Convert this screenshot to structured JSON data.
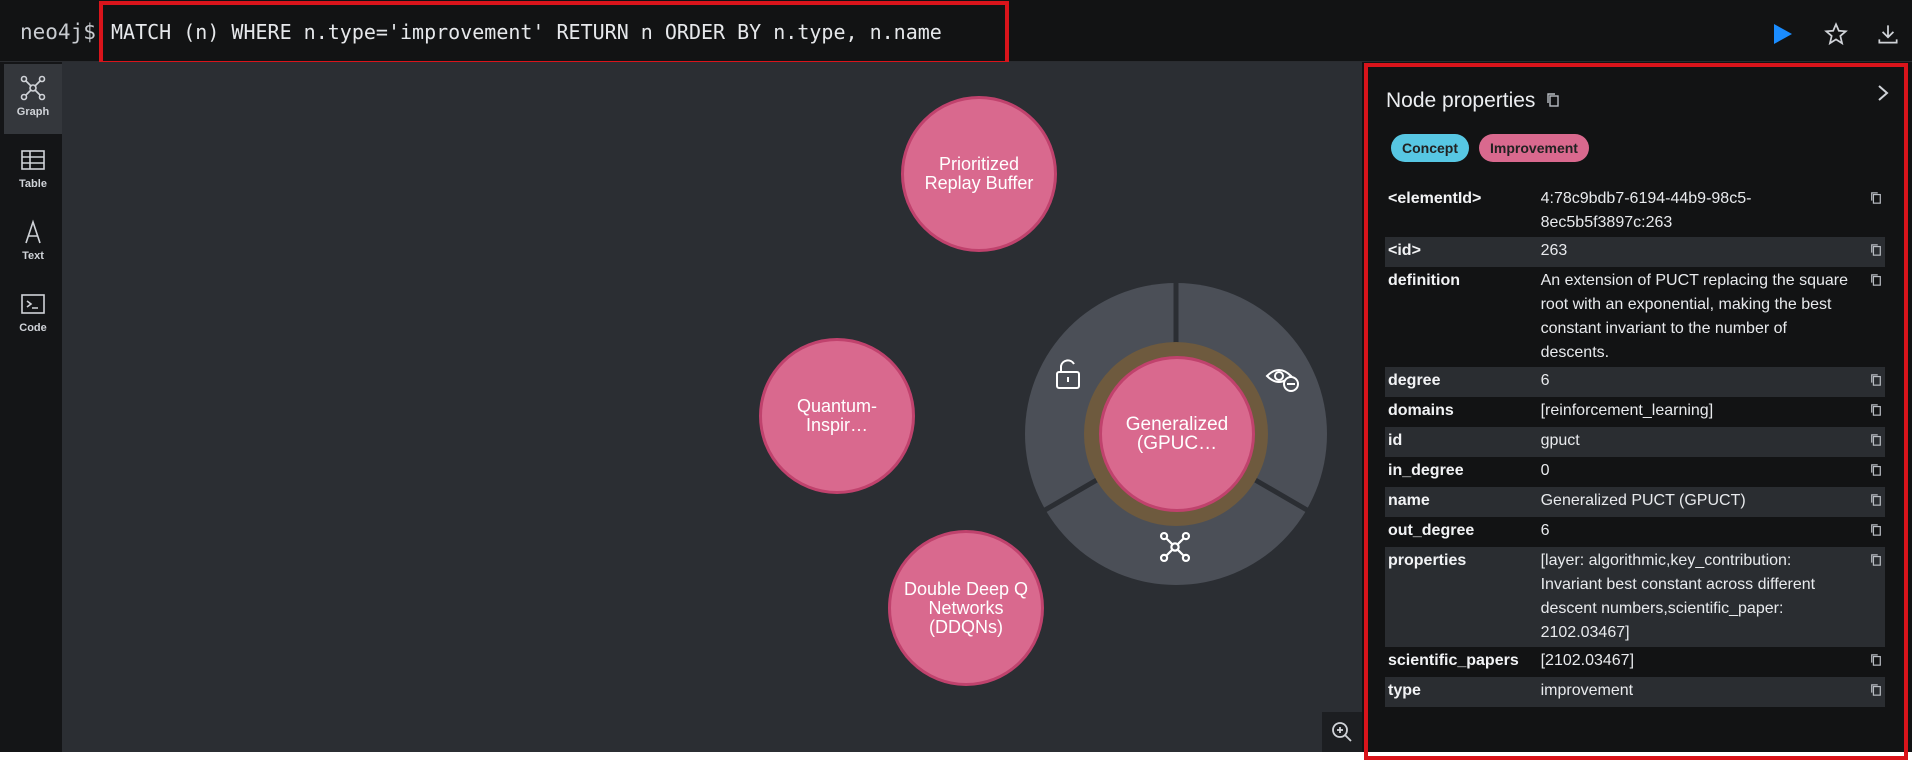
{
  "query": {
    "prompt": "neo4j$",
    "text": "MATCH (n) WHERE n.type='improvement' RETURN n ORDER BY n.type, n.name"
  },
  "sidebar": {
    "items": [
      {
        "label": "Graph",
        "icon": "graph-icon",
        "active": true
      },
      {
        "label": "Table",
        "icon": "table-icon"
      },
      {
        "label": "Text",
        "icon": "text-icon"
      },
      {
        "label": "Code",
        "icon": "code-icon"
      }
    ]
  },
  "graph": {
    "nodes": [
      {
        "caption_line1": "Prioritized",
        "caption_line2": "Replay Buffer"
      },
      {
        "caption_line1": "Quantum-Inspir…"
      },
      {
        "caption_line1": "Double Deep Q",
        "caption_line2": "Networks",
        "caption_line3": "(DDQNs)"
      },
      {
        "caption_line1": "Generalized",
        "caption_line2": "(GPUC…",
        "selected": true
      }
    ],
    "node_color": "#d9698e",
    "node_border": "#c0426d",
    "ring_menu": [
      "unlock-icon",
      "hide-icon",
      "expand-icon"
    ]
  },
  "panel": {
    "title": "Node properties",
    "labels": [
      {
        "text": "Concept",
        "color": "#57c7e3"
      },
      {
        "text": "Improvement",
        "color": "#d9698e"
      }
    ],
    "properties": [
      {
        "key": "<elementId>",
        "value": "4:78c9bdb7-6194-44b9-98c5-8ec5b5f3897c:263"
      },
      {
        "key": "<id>",
        "value": "263"
      },
      {
        "key": "definition",
        "value": "An extension of PUCT replacing the square root with an exponential, making the best constant invariant to the number of descents."
      },
      {
        "key": "degree",
        "value": "6"
      },
      {
        "key": "domains",
        "value": "[reinforcement_learning]"
      },
      {
        "key": "id",
        "value": "gpuct"
      },
      {
        "key": "in_degree",
        "value": "0"
      },
      {
        "key": "name",
        "value": "Generalized PUCT (GPUCT)"
      },
      {
        "key": "out_degree",
        "value": "6"
      },
      {
        "key": "properties",
        "value": "[layer: algorithmic,key_contribution: Invariant best constant across different descent numbers,scientific_paper: 2102.03467]"
      },
      {
        "key": "scientific_papers",
        "value": "[2102.03467]"
      },
      {
        "key": "type",
        "value": "improvement"
      }
    ]
  },
  "colors": {
    "accent": "#1a8cff",
    "highlight": "#d9141b"
  }
}
